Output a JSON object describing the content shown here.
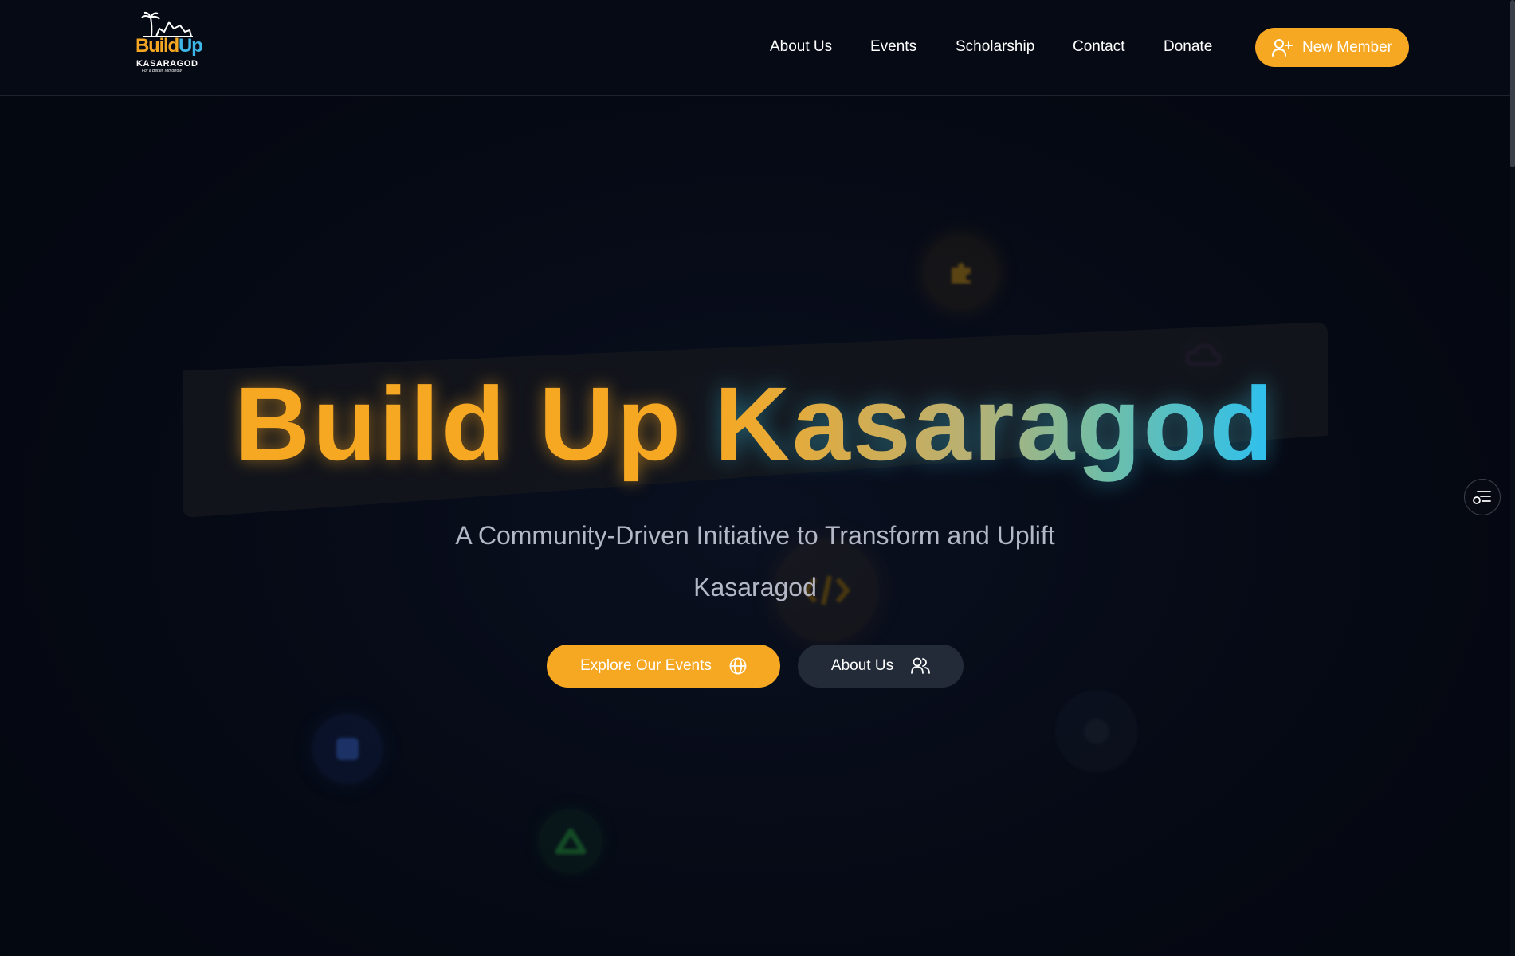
{
  "brand": {
    "logo_build": "Build",
    "logo_up": "Up",
    "logo_sub": "KASARAGOD",
    "logo_tag": "For a Better Tomorrow"
  },
  "nav": {
    "items": [
      {
        "label": "About Us"
      },
      {
        "label": "Events"
      },
      {
        "label": "Scholarship"
      },
      {
        "label": "Contact"
      },
      {
        "label": "Donate"
      }
    ],
    "cta_label": "New Member",
    "cta_icon": "user-plus-icon"
  },
  "hero": {
    "title_part1": "Build Up",
    "title_part2": "Kasaragod",
    "subtitle_line1": "A Community-Driven Initiative to Transform and Uplift",
    "subtitle_line2": "Kasaragod",
    "primary_button": {
      "label": "Explore Our Events",
      "icon": "globe-icon"
    },
    "secondary_button": {
      "label": "About Us",
      "icon": "users-icon"
    }
  },
  "floating_icons": [
    "puzzle-icon",
    "cloud-icon",
    "code-icon",
    "database-icon",
    "atom-icon",
    "recycle-icon"
  ],
  "side_widget_icon": "accessibility-menu-icon",
  "colors": {
    "accent": "#f7a823",
    "accent_blue": "#2cc0f0",
    "background": "#050913",
    "secondary_button": "#232a38"
  }
}
